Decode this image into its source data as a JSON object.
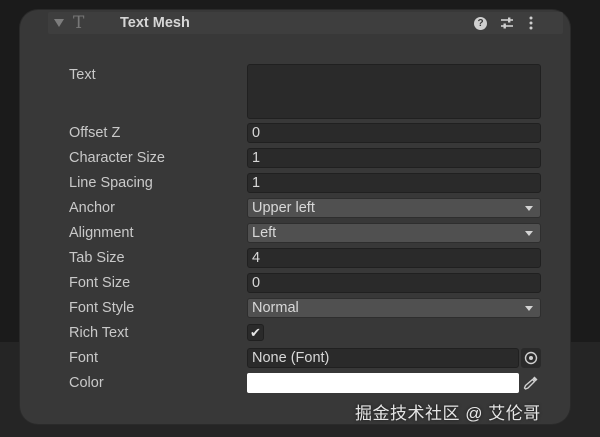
{
  "component": {
    "title": "Text Mesh",
    "icons": {
      "fold": "triangle-down-icon",
      "component": "text-component-icon",
      "help": "help-icon",
      "settings": "sliders-icon",
      "more": "kebab-menu-icon"
    },
    "component_icon_glyph": "T",
    "help_glyph": "?"
  },
  "properties": {
    "text": {
      "label": "Text",
      "value": ""
    },
    "offset_z": {
      "label": "Offset Z",
      "value": "0"
    },
    "character_size": {
      "label": "Character Size",
      "value": "1"
    },
    "line_spacing": {
      "label": "Line Spacing",
      "value": "1"
    },
    "anchor": {
      "label": "Anchor",
      "value": "Upper left"
    },
    "alignment": {
      "label": "Alignment",
      "value": "Left"
    },
    "tab_size": {
      "label": "Tab Size",
      "value": "4"
    },
    "font_size": {
      "label": "Font Size",
      "value": "0"
    },
    "font_style": {
      "label": "Font Style",
      "value": "Normal"
    },
    "rich_text": {
      "label": "Rich Text",
      "checked": true,
      "glyph": "✔"
    },
    "font": {
      "label": "Font",
      "value": "None (Font)"
    },
    "color": {
      "label": "Color",
      "value": "#ffffff"
    }
  },
  "watermark": "掘金技术社区 @ 艾伦哥",
  "colors": {
    "panel": "#383838",
    "field": "#2a2a2a",
    "dropdown": "#505050",
    "text": "#c9c9c9"
  }
}
